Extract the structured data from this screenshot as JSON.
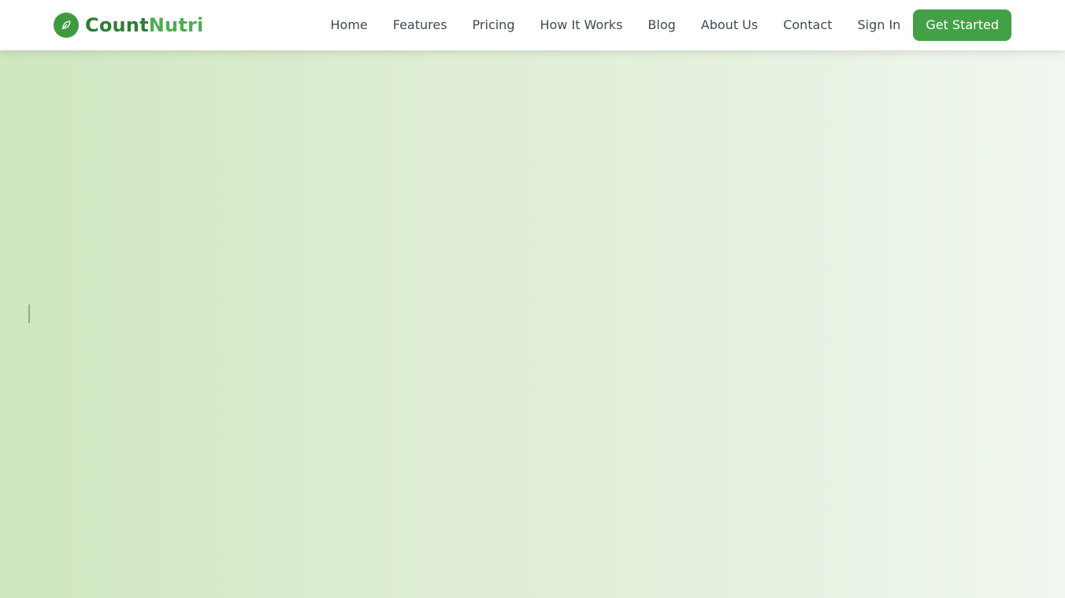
{
  "brand": {
    "name_part1": "Count",
    "name_part2": "Nutri",
    "icon": "leaf-icon"
  },
  "nav": {
    "links": [
      "Home",
      "Features",
      "Pricing",
      "How It Works",
      "Blog",
      "About Us",
      "Contact"
    ],
    "sign_in": "Sign In",
    "get_started": "Get Started"
  },
  "colors": {
    "brand_dark": "#2f7d32",
    "brand_light": "#4caf50",
    "accent": "#43a047",
    "nav_text": "#3f4a55",
    "hero_gradient_start": "#cfe6bf",
    "hero_gradient_end": "#f0f7ef"
  }
}
